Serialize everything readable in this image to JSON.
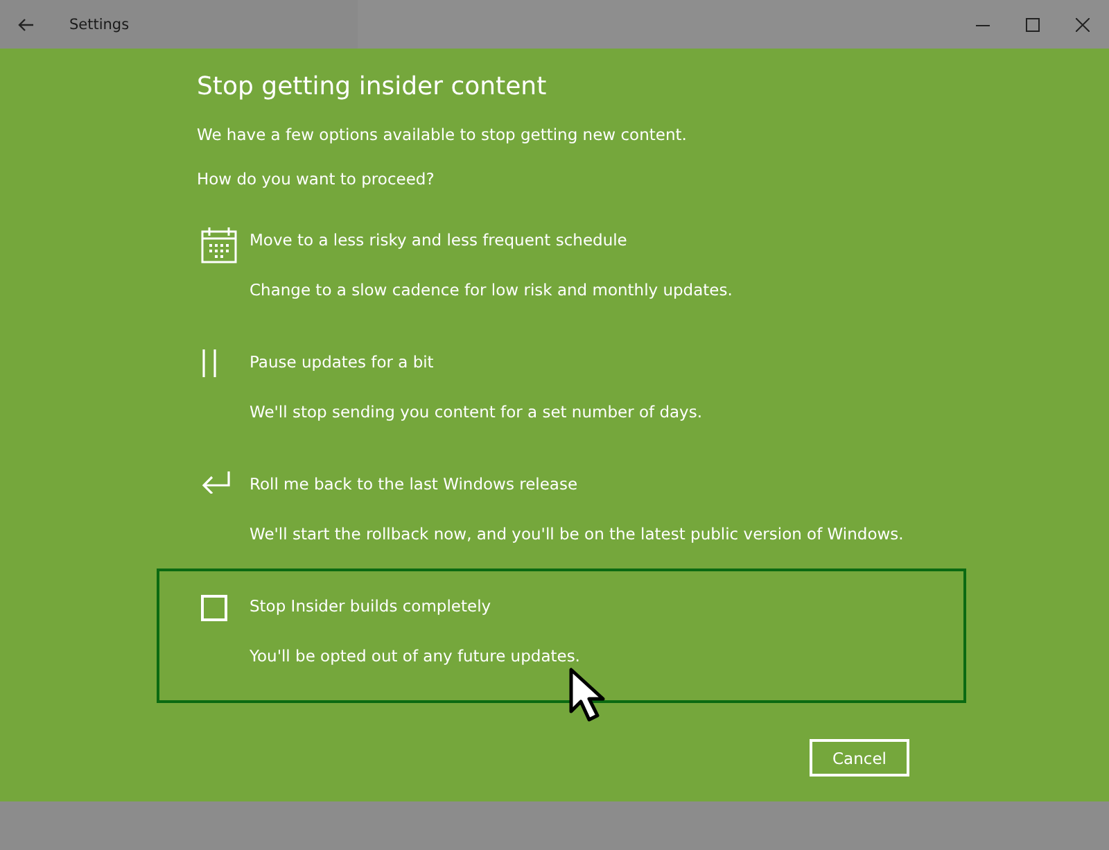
{
  "window": {
    "title": "Settings"
  },
  "heading": "Stop getting insider content",
  "intro": [
    "We have a few options available to stop getting new content.",
    "How do you want to proceed?"
  ],
  "options": [
    {
      "kind": "calendar",
      "title": "Move to a less risky and less frequent schedule",
      "description": "Change to a slow cadence for low risk and monthly updates.",
      "selected": false
    },
    {
      "kind": "pause",
      "title": "Pause updates for a bit",
      "description": "We'll stop sending you content for a set number of days.",
      "selected": false
    },
    {
      "kind": "rollback",
      "title": "Roll me back to the last Windows release",
      "description": "We'll start the rollback now, and you'll be on the latest public version of Windows.",
      "selected": false
    },
    {
      "kind": "checkbox",
      "checked": false,
      "title": "Stop Insider builds completely",
      "description": "You'll be opted out of any future updates.",
      "selected": true
    }
  ],
  "buttons": [
    "Cancel"
  ]
}
